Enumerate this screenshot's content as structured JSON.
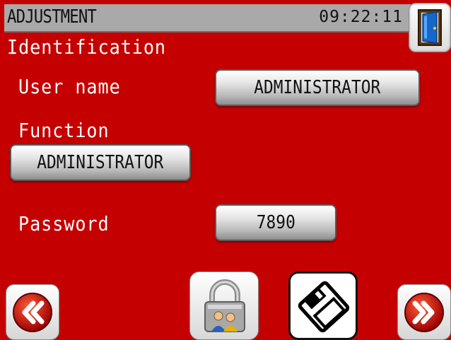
{
  "header": {
    "title": "ADJUSTMENT",
    "time": "09:22:11"
  },
  "section": {
    "title": "Identification"
  },
  "form": {
    "user_name_label": "User name",
    "user_name_value": "ADMINISTRATOR",
    "function_label": "Function",
    "function_value": "ADMINISTRATOR",
    "password_label": "Password",
    "password_value": "7890"
  },
  "icons": {
    "exit": "door-exit-icon",
    "previous": "double-chevron-left-icon",
    "lock": "padlock-users-icon",
    "save": "floppy-disk-icon",
    "next": "double-chevron-right-icon"
  },
  "colors": {
    "background": "#c50000",
    "title_bar": "#a9a9a9",
    "text": "#ffffff"
  }
}
